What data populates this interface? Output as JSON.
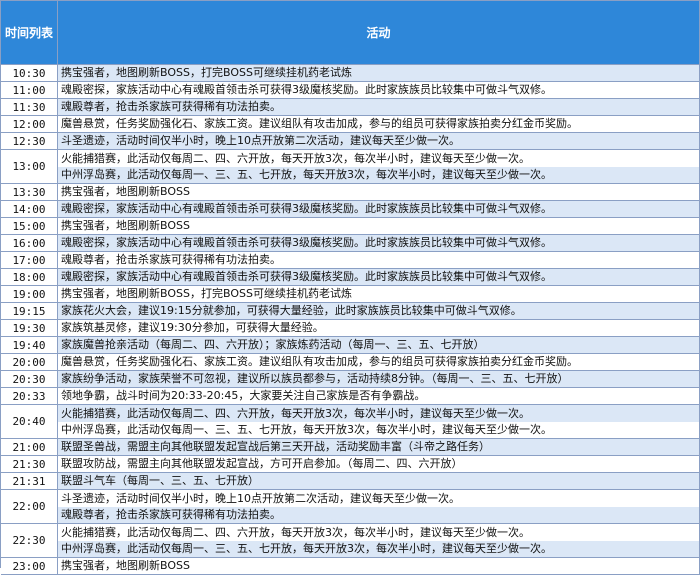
{
  "header": {
    "time_col": "时间列表",
    "activity_col": "活动"
  },
  "rows": [
    {
      "time": "10:30",
      "acts": [
        "携宝强者，地图刷新BOSS，打完BOSS可继续挂机药老试炼"
      ]
    },
    {
      "time": "11:00",
      "acts": [
        "魂殿密探，家族活动中心有魂殿首领击杀可获得3级魔核奖励。此时家族族员比较集中可做斗气双修。"
      ]
    },
    {
      "time": "11:30",
      "acts": [
        "魂殿尊者，抢击杀家族可获得稀有功法拍卖。"
      ]
    },
    {
      "time": "12:00",
      "acts": [
        "魔兽悬赏，任务奖励强化石、家族工资。建议组队有攻击加成，参与的组员可获得家族拍卖分红金币奖励。"
      ]
    },
    {
      "time": "12:30",
      "acts": [
        "斗圣遗迹，活动时间仅半小时，晚上10点开放第二次活动，建议每天至少做一次。"
      ]
    },
    {
      "time": "13:00",
      "acts": [
        "火能捕猎赛，此活动仅每周二、四、六开放，每天开放3次，每次半小时，建议每天至少做一次。",
        "中州浮岛赛，此活动仅每周一、三、五、七开放，每天开放3次，每次半小时，建议每天至少做一次。"
      ]
    },
    {
      "time": "13:30",
      "acts": [
        "携宝强者，地图刷新BOSS"
      ]
    },
    {
      "time": "14:00",
      "acts": [
        "魂殿密探，家族活动中心有魂殿首领击杀可获得3级魔核奖励。此时家族族员比较集中可做斗气双修。"
      ]
    },
    {
      "time": "15:00",
      "acts": [
        "携宝强者，地图刷新BOSS"
      ]
    },
    {
      "time": "16:00",
      "acts": [
        "魂殿密探，家族活动中心有魂殿首领击杀可获得3级魔核奖励。此时家族族员比较集中可做斗气双修。"
      ]
    },
    {
      "time": "17:00",
      "acts": [
        "魂殿尊者，抢击杀家族可获得稀有功法拍卖。"
      ]
    },
    {
      "time": "18:00",
      "acts": [
        "魂殿密探，家族活动中心有魂殿首领击杀可获得3级魔核奖励。此时家族族员比较集中可做斗气双修。"
      ]
    },
    {
      "time": "19:00",
      "acts": [
        "携宝强者，地图刷新BOSS，打完BOSS可继续挂机药老试炼"
      ]
    },
    {
      "time": "19:15",
      "acts": [
        "家族花火大会，建议19:15分就参加，可获得大量经验，此时家族族员比较集中可做斗气双修。"
      ]
    },
    {
      "time": "19:30",
      "acts": [
        "家族筑基灵修，建议19:30分参加，可获得大量经验。"
      ]
    },
    {
      "time": "19:40",
      "acts": [
        "家族魔兽抢亲活动（每周二、四、六开放）；家族炼药活动（每周一、三、五、七开放）"
      ]
    },
    {
      "time": "20:00",
      "acts": [
        "魔兽悬赏，任务奖励强化石、家族工资。建议组队有攻击加成，参与的组员可获得家族拍卖分红金币奖励。"
      ]
    },
    {
      "time": "20:30",
      "acts": [
        "家族纷争活动，家族荣誉不可忽视，建议所以族员都参与，活动持续8分钟。（每周一、三、五、七开放）"
      ]
    },
    {
      "time": "20:33",
      "acts": [
        "领地争霸，战斗时间为20:33-20:45，大家要关注自己家族是否有争霸战。"
      ]
    },
    {
      "time": "20:40",
      "acts": [
        "火能捕猎赛，此活动仅每周二、四、六开放，每天开放3次，每次半小时，建议每天至少做一次。",
        "中州浮岛赛，此活动仅每周一、三、五、七开放，每天开放3次，每次半小时，建议每天至少做一次。"
      ]
    },
    {
      "time": "21:00",
      "acts": [
        "联盟圣兽战，需盟主向其他联盟发起宣战后第三天开战，活动奖励丰富（斗帝之路任务）"
      ]
    },
    {
      "time": "21:30",
      "acts": [
        "联盟攻防战，需盟主向其他联盟发起宣战，方可开启参加。（每周二、四、六开放）"
      ]
    },
    {
      "time": "21:31",
      "acts": [
        "联盟斗气车（每周一、三、五、七开放）"
      ]
    },
    {
      "time": "22:00",
      "acts": [
        "斗圣遗迹，活动时间仅半小时，晚上10点开放第二次活动，建议每天至少做一次。",
        "魂殿尊者，抢击杀家族可获得稀有功法拍卖。"
      ]
    },
    {
      "time": "22:30",
      "acts": [
        "火能捕猎赛，此活动仅每周二、四、六开放，每天开放3次，每次半小时，建议每天至少做一次。",
        "中州浮岛赛，此活动仅每周一、三、五、七开放，每天开放3次，每次半小时，建议每天至少做一次。"
      ]
    },
    {
      "time": "23:00",
      "acts": [
        "携宝强者，地图刷新BOSS"
      ]
    }
  ]
}
